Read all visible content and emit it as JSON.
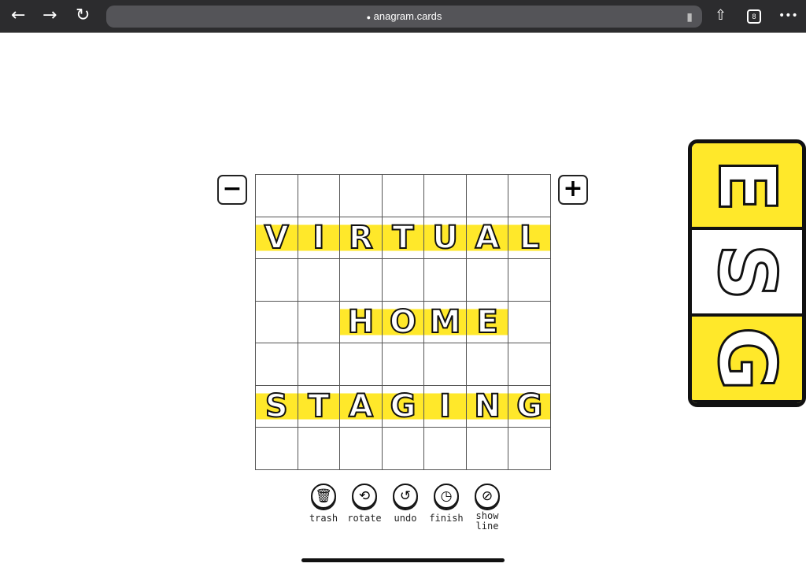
{
  "browser": {
    "url": "anagram.cards",
    "tab_count": "8",
    "back": "←",
    "forward": "→",
    "reload": "↻",
    "share": "⇧",
    "more": "•••",
    "lock": "🔒",
    "mic": "🎙"
  },
  "controls": {
    "zoom_out": "−",
    "zoom_in": "+"
  },
  "board": {
    "rows": [
      [
        "",
        "",
        "",
        "",
        "",
        "",
        ""
      ],
      [
        "V",
        "I",
        "R",
        "T",
        "U",
        "A",
        "L"
      ],
      [
        "",
        "",
        "",
        "",
        "",
        "",
        ""
      ],
      [
        "",
        "",
        "H",
        "O",
        "M",
        "E",
        ""
      ],
      [
        "",
        "",
        "",
        "",
        "",
        "",
        ""
      ],
      [
        "S",
        "T",
        "A",
        "G",
        "I",
        "N",
        "G"
      ],
      [
        "",
        "",
        "",
        "",
        "",
        "",
        ""
      ]
    ],
    "accent": "#ffe82a"
  },
  "side_card": {
    "letters": [
      "E",
      "S",
      "G"
    ]
  },
  "tools": [
    {
      "label": "trash",
      "icon": "🗑"
    },
    {
      "label": "rotate",
      "icon": "⟲"
    },
    {
      "label": "undo",
      "icon": "↺"
    },
    {
      "label": "finish",
      "icon": "◷"
    },
    {
      "label": "show line",
      "icon": "⊘"
    }
  ]
}
